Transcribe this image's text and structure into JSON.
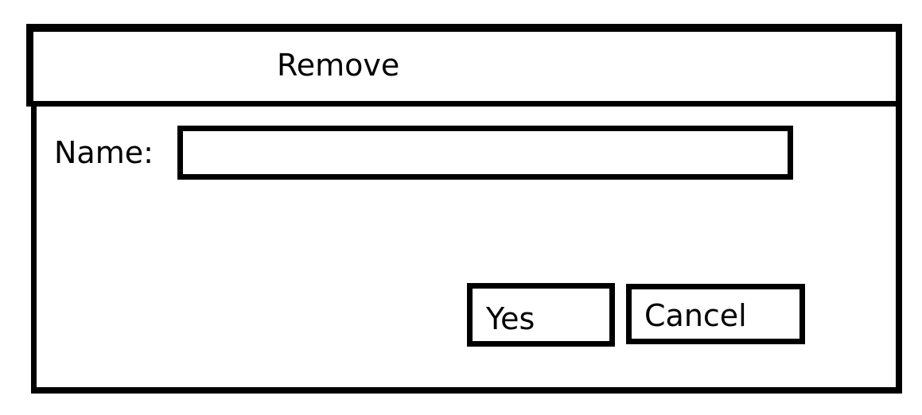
{
  "dialog": {
    "title": "Remove",
    "name_label": "Name:",
    "name_value": "",
    "name_placeholder": "",
    "yes_label": "Yes",
    "cancel_label": "Cancel"
  },
  "colors": {
    "border": "#000000",
    "background": "#ffffff",
    "text": "#000000"
  }
}
